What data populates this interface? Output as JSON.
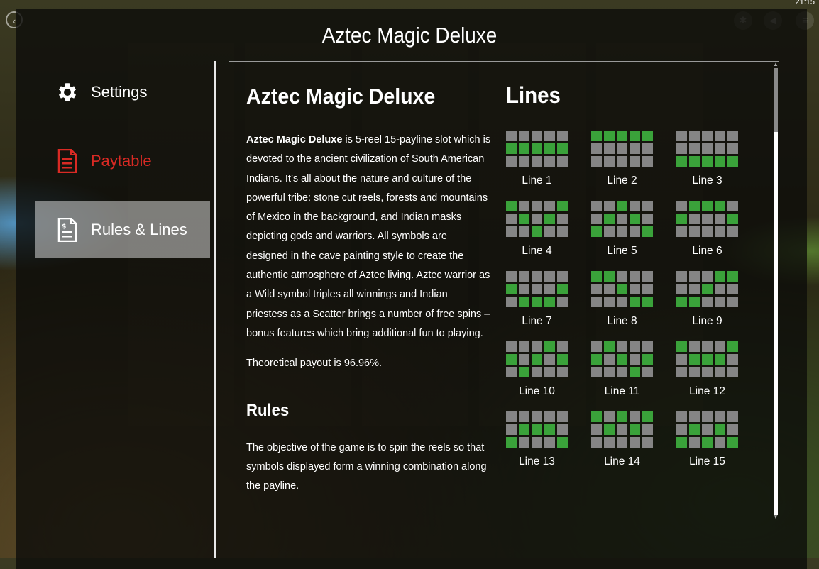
{
  "status": {
    "clock": "21:15"
  },
  "window": {
    "title": "Aztec Magic Deluxe"
  },
  "nav": {
    "settings": "Settings",
    "paytable": "Paytable",
    "rules_lines": "Rules & Lines",
    "active": "rules_lines"
  },
  "content": {
    "heading": "Aztec Magic Deluxe",
    "intro_bold": "Aztec Magic Deluxe",
    "intro_rest": " is 5-reel 15-payline slot which is devoted to the ancient civilization of South American Indians. It’s all about the nature and culture of the powerful tribe: stone cut reels, forests and mountains of Mexico in the background, and Indian masks depicting gods and warriors. All symbols are designed in the cave painting style to create the authentic atmosphere of Aztec living. Aztec warrior as a Wild symbol triples all winnings and Indian priestess as a Scatter brings a number of free spins – bonus features which bring additional fun to playing.",
    "payout": "Theoretical payout is 96.96%.",
    "rules_heading": "Rules",
    "rules_text": "The objective of the game is to spin the reels so that symbols displayed form a winning combination along the payline."
  },
  "lines": {
    "title": "Lines",
    "active_color": "#3aa23a",
    "inactive_color": "#858585",
    "items": [
      {
        "label": "Line 1",
        "rows": [
          1,
          1,
          1,
          1,
          1
        ]
      },
      {
        "label": "Line 2",
        "rows": [
          0,
          0,
          0,
          0,
          0
        ]
      },
      {
        "label": "Line 3",
        "rows": [
          2,
          2,
          2,
          2,
          2
        ]
      },
      {
        "label": "Line 4",
        "rows": [
          0,
          1,
          2,
          1,
          0
        ]
      },
      {
        "label": "Line 5",
        "rows": [
          2,
          1,
          0,
          1,
          2
        ]
      },
      {
        "label": "Line 6",
        "rows": [
          1,
          0,
          0,
          0,
          1
        ]
      },
      {
        "label": "Line 7",
        "rows": [
          1,
          2,
          2,
          2,
          1
        ]
      },
      {
        "label": "Line 8",
        "rows": [
          0,
          0,
          1,
          2,
          2
        ]
      },
      {
        "label": "Line 9",
        "rows": [
          2,
          2,
          1,
          0,
          0
        ]
      },
      {
        "label": "Line 10",
        "rows": [
          1,
          2,
          1,
          0,
          1
        ]
      },
      {
        "label": "Line 11",
        "rows": [
          1,
          0,
          1,
          2,
          1
        ]
      },
      {
        "label": "Line 12",
        "rows": [
          0,
          1,
          1,
          1,
          0
        ]
      },
      {
        "label": "Line 13",
        "rows": [
          2,
          1,
          1,
          1,
          2
        ]
      },
      {
        "label": "Line 14",
        "rows": [
          0,
          1,
          0,
          1,
          0
        ]
      },
      {
        "label": "Line 15",
        "rows": [
          2,
          1,
          2,
          1,
          2
        ]
      }
    ]
  }
}
